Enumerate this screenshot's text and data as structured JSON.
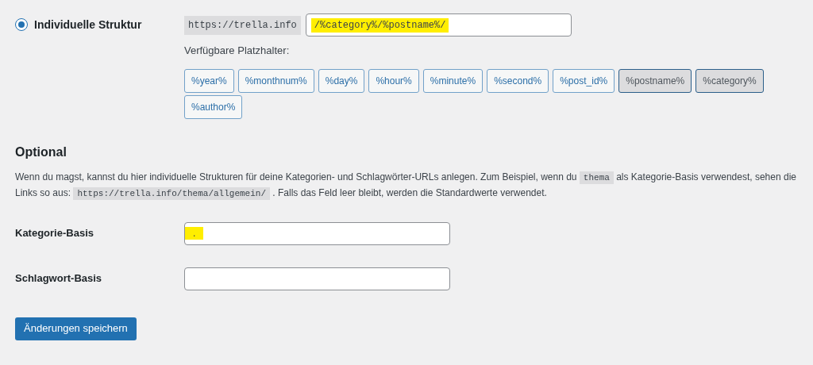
{
  "structure": {
    "selected": true,
    "label": "Individuelle Struktur",
    "prefix": "https://trella.info",
    "value": "/%category%/%postname%/",
    "highlighted": true
  },
  "placeholders": {
    "label": "Verfügbare Platzhalter:",
    "tags": [
      {
        "label": "%year%",
        "selected": false
      },
      {
        "label": "%monthnum%",
        "selected": false
      },
      {
        "label": "%day%",
        "selected": false
      },
      {
        "label": "%hour%",
        "selected": false
      },
      {
        "label": "%minute%",
        "selected": false
      },
      {
        "label": "%second%",
        "selected": false
      },
      {
        "label": "%post_id%",
        "selected": false
      },
      {
        "label": "%postname%",
        "selected": true
      },
      {
        "label": "%category%",
        "selected": true
      },
      {
        "label": "%author%",
        "selected": false
      }
    ]
  },
  "optional": {
    "heading": "Optional",
    "paragraph": [
      {
        "kind": "text",
        "text": "Wenn du magst, kannst du hier individuelle Strukturen für deine Kategorien- und Schlagwörter-URLs anlegen. Zum Beispiel, wenn du "
      },
      {
        "kind": "code",
        "text": "thema"
      },
      {
        "kind": "text",
        "text": " als Kategorie-Basis verwendest, sehen die Links so aus: "
      },
      {
        "kind": "code",
        "text": "https://trella.info/thema/allgemein/"
      },
      {
        "kind": "text",
        "text": " . Falls das Feld leer bleibt, werden die Standardwerte verwendet."
      }
    ]
  },
  "fields": [
    {
      "label": "Kategorie-Basis",
      "value": ".",
      "highlighted": true
    },
    {
      "label": "Schlagwort-Basis"
    }
  ],
  "button": "Änderungen speichern"
}
